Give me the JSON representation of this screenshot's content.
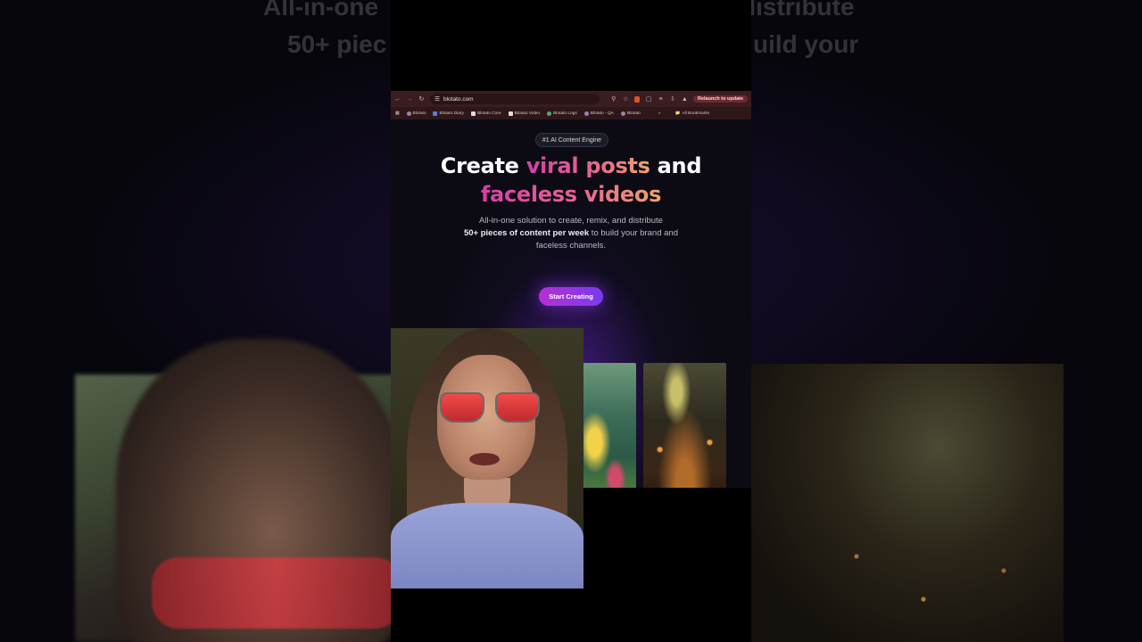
{
  "backdrop": {
    "line1_left": "All-in-one",
    "line1_right": "distribute",
    "line2_left": "50+ piec",
    "line2_right": "uild your"
  },
  "browser": {
    "url": "blotato.com",
    "relaunch_label": "Relaunch to update",
    "bookmarks": [
      "Blotato",
      "Blotato Diary",
      "Blotato Core",
      "Blotato Video",
      "Blotato Logs",
      "Blotato - QA",
      "Blotato"
    ],
    "all_bookmarks": "All Bookmarks"
  },
  "hero": {
    "badge": "#1 AI Content Engine",
    "headline_plain_1": "Create ",
    "headline_grad_1": "viral posts",
    "headline_plain_2": " and",
    "headline_grad_2": "faceless videos",
    "sub_1": "All-in-one solution to create, remix, and distribute",
    "sub_bold": "50+ pieces of content per week",
    "sub_2": " to build your brand and faceless channels.",
    "cta": "Start Creating"
  },
  "colors": {
    "accent_from": "#b72fd6",
    "accent_to": "#7a3af0",
    "headline_gradient": [
      "#d63fa8",
      "#e86a8e",
      "#f0a46a"
    ],
    "toolbar": "#3a1d20"
  },
  "icons": [
    "back-arrow-icon",
    "forward-arrow-icon",
    "reload-icon",
    "site-info-icon",
    "zoom-icon",
    "star-icon",
    "extension-icon",
    "download-icon",
    "apps-grid-icon",
    "folder-icon"
  ]
}
